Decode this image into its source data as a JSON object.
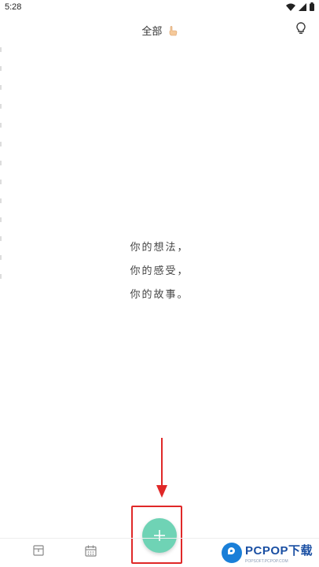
{
  "status_bar": {
    "time": "5:28",
    "icons": [
      "wifi-icon",
      "signal-icon",
      "battery-icon"
    ]
  },
  "header": {
    "title": "全部",
    "title_icon": "pointing-hand-icon",
    "action_icon": "lightbulb-icon"
  },
  "quote": {
    "line1": "你的想法，",
    "line2": "你的感受，",
    "line3": "你的故事。"
  },
  "fab": {
    "icon": "plus-icon",
    "color": "#6fd3b5"
  },
  "annotation": {
    "highlight_color": "#e02828",
    "arrow_color": "#e02828"
  },
  "bottom_nav": {
    "items": [
      "archive-icon",
      "calendar-icon"
    ]
  },
  "watermark": {
    "brand": "PCPOP下载",
    "tagline": "POPSOFT.PCPOP.COM"
  }
}
